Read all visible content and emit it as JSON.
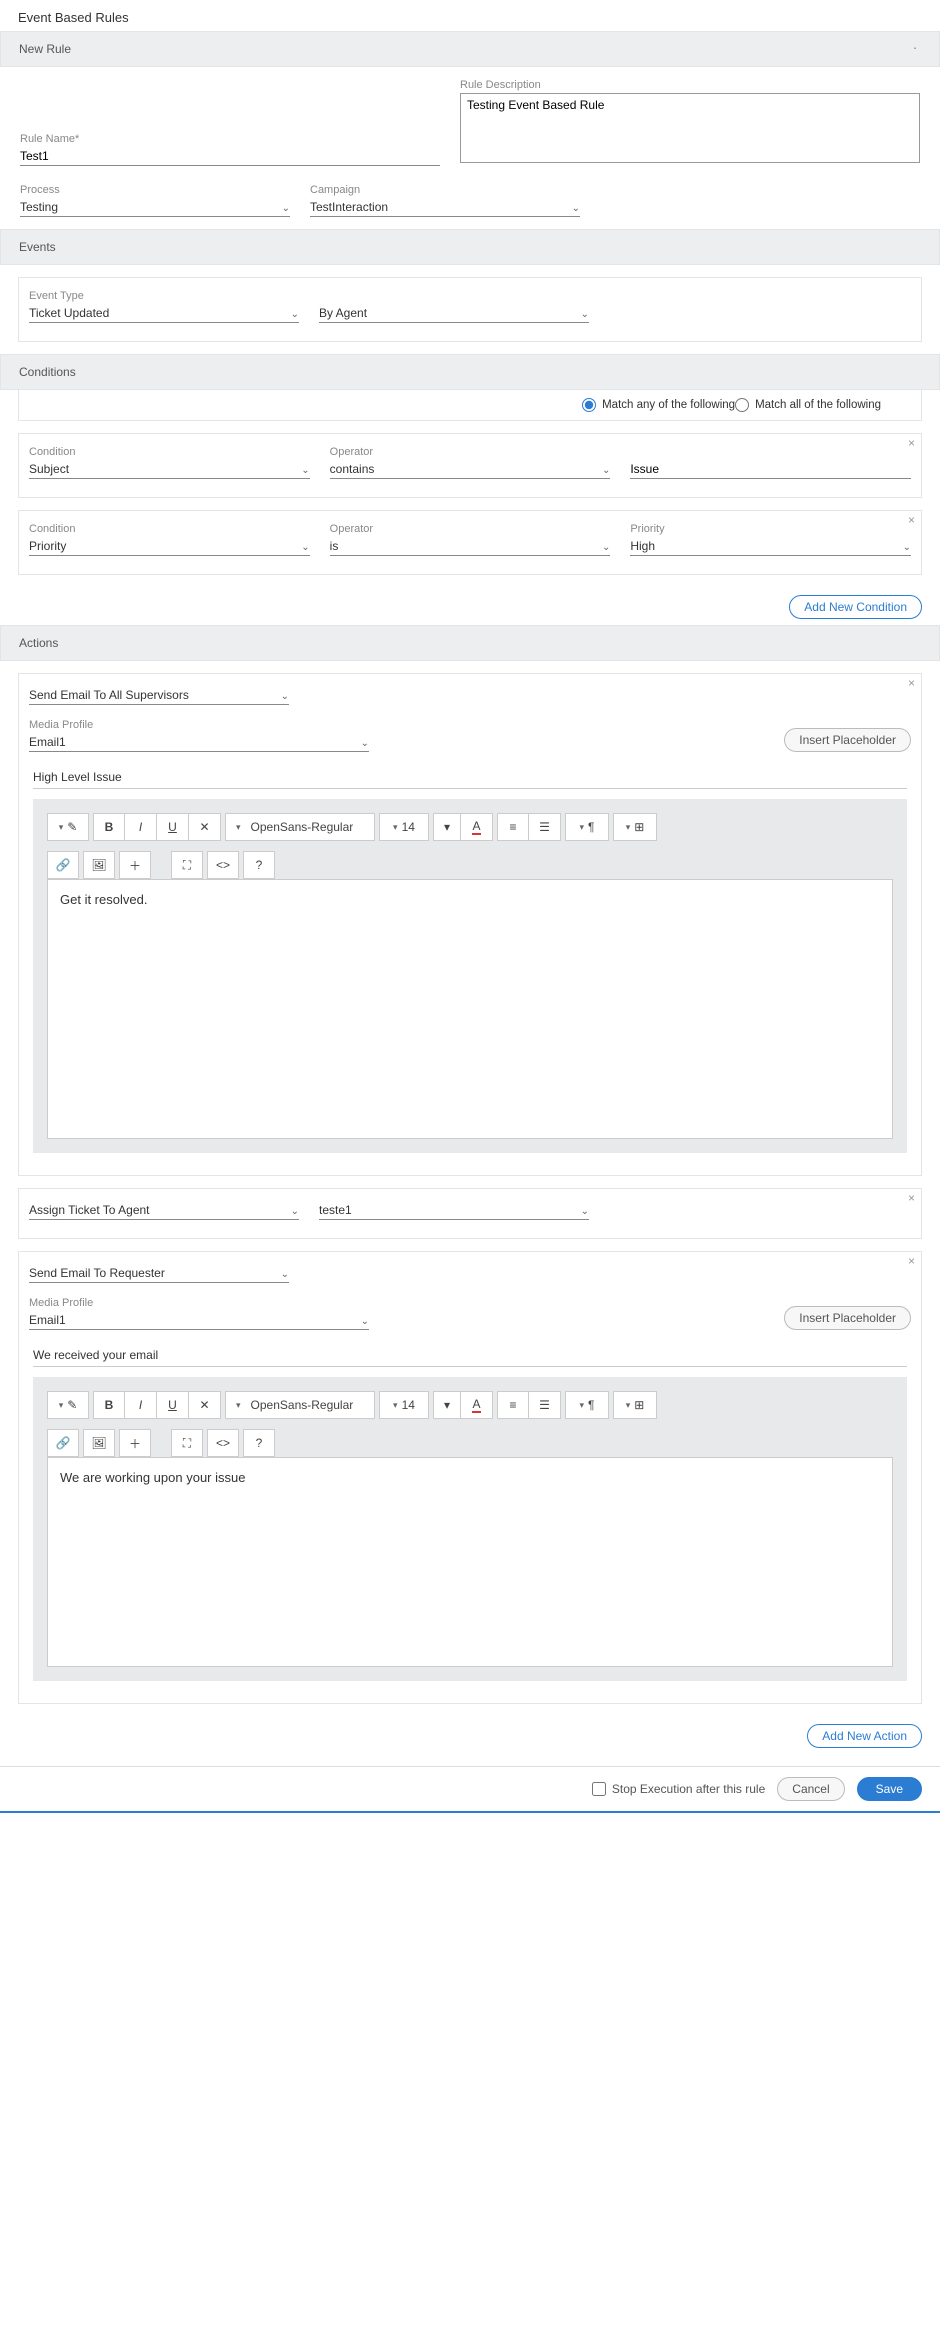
{
  "page_title": "Event Based Rules",
  "new_rule_header": "New Rule",
  "rule_name_label": "Rule Name*",
  "rule_name_value": "Test1",
  "rule_desc_label": "Rule Description",
  "rule_desc_value": "Testing Event Based Rule",
  "process_label": "Process",
  "process_value": "Testing",
  "campaign_label": "Campaign",
  "campaign_value": "TestInteraction",
  "events_header": "Events",
  "event_type_label": "Event Type",
  "event_type_value": "Ticket Updated",
  "event_by_value": "By Agent",
  "conditions_header": "Conditions",
  "match_any": "Match any of the following",
  "match_all": "Match all of the following",
  "cond1": {
    "label": "Condition",
    "field": "Subject",
    "op_label": "Operator",
    "op": "contains",
    "value": "Issue"
  },
  "cond2": {
    "label": "Condition",
    "field": "Priority",
    "op_label": "Operator",
    "op": "is",
    "val_label": "Priority",
    "value": "High"
  },
  "add_cond_btn": "Add New Condition",
  "actions_header": "Actions",
  "action1": {
    "type": "Send Email To All Supervisors",
    "media_label": "Media Profile",
    "media_value": "Email1",
    "insert_btn": "Insert Placeholder",
    "subject": "High Level Issue",
    "body": "Get it resolved."
  },
  "action2": {
    "type": "Assign Ticket To Agent",
    "value": "teste1"
  },
  "action3": {
    "type": "Send Email To Requester",
    "media_label": "Media Profile",
    "media_value": "Email1",
    "insert_btn": "Insert Placeholder",
    "subject": "We received your email",
    "body": "We are working upon your issue"
  },
  "add_action_btn": "Add New Action",
  "stop_exec": "Stop Execution after this rule",
  "cancel": "Cancel",
  "save": "Save",
  "rte": {
    "font": "OpenSans-Regular",
    "size": "14"
  }
}
